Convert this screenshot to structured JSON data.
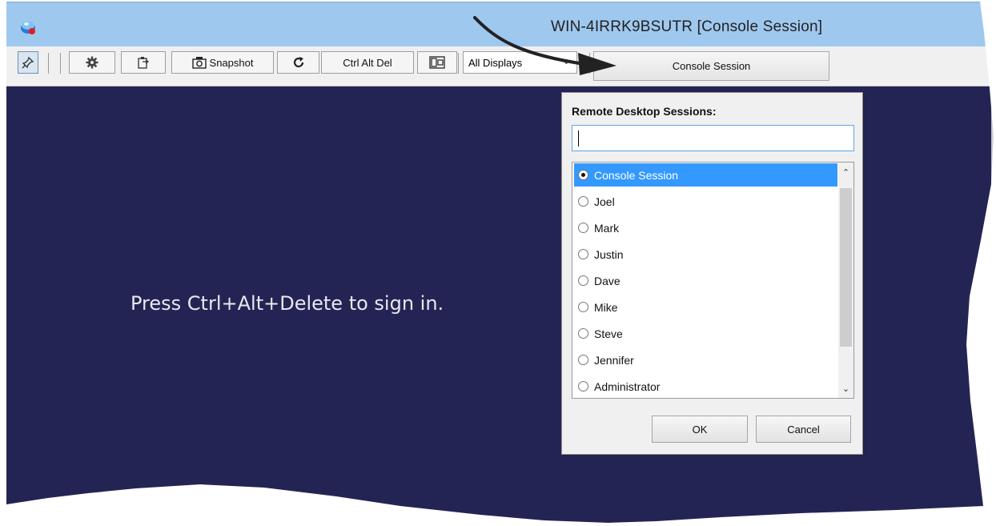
{
  "window": {
    "title": "WIN-4IRRK9BSUTR [Console Session]"
  },
  "toolbar": {
    "pin_icon": "pin-icon",
    "settings_icon": "gear-icon",
    "clipboard_icon": "clipboard-icon",
    "snapshot_label": "Snapshot",
    "refresh_icon": "refresh-icon",
    "cad_label": "Ctrl Alt Del",
    "monitor_icon": "monitor-layout-icon",
    "display_selected": "All Displays",
    "session_button_label": "Console Session"
  },
  "remote": {
    "message": "Press Ctrl+Alt+Delete to sign in.",
    "background": "#242454"
  },
  "session_panel": {
    "title": "Remote Desktop Sessions:",
    "search_value": "",
    "items": [
      {
        "label": "Console Session",
        "selected": true
      },
      {
        "label": "Joel",
        "selected": false
      },
      {
        "label": "Mark",
        "selected": false
      },
      {
        "label": "Justin",
        "selected": false
      },
      {
        "label": "Dave",
        "selected": false
      },
      {
        "label": "Mike",
        "selected": false
      },
      {
        "label": "Steve",
        "selected": false
      },
      {
        "label": "Jennifer",
        "selected": false
      },
      {
        "label": "Administrator",
        "selected": false
      }
    ],
    "ok_label": "OK",
    "cancel_label": "Cancel"
  },
  "colors": {
    "titlebar": "#9fc8ef",
    "selection": "#3399ff",
    "search_border": "#5fa6e0"
  }
}
